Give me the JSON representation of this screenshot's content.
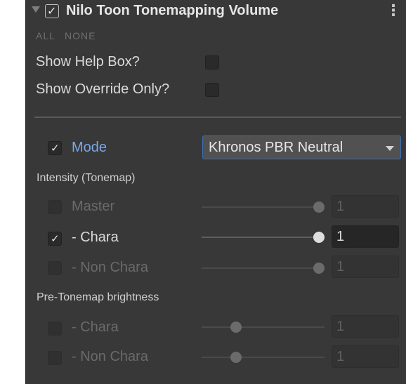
{
  "header": {
    "title": "Nilo Toon Tonemapping Volume",
    "enabled": true,
    "menu_glyph": "⋮",
    "collapse_glyph": "▼"
  },
  "quick_select": {
    "all": "ALL",
    "none": "NONE"
  },
  "options": {
    "show_help_box": {
      "label": "Show Help Box?",
      "checked": false
    },
    "show_override_only": {
      "label": "Show Override Only?",
      "checked": false
    }
  },
  "mode": {
    "label": "Mode",
    "override": true,
    "selected": "Khronos PBR Neutral"
  },
  "intensity_section": {
    "title": "Intensity (Tonemap)",
    "rows": [
      {
        "label": "Master",
        "override": false,
        "value": "1",
        "slider_fraction": 1.0
      },
      {
        "label": "-  Chara",
        "override": true,
        "value": "1",
        "slider_fraction": 1.0
      },
      {
        "label": "-  Non Chara",
        "override": false,
        "value": "1",
        "slider_fraction": 1.0
      }
    ]
  },
  "pretonemap_section": {
    "title": "Pre-Tonemap brightness",
    "rows": [
      {
        "label": "-  Chara",
        "override": false,
        "value": "1",
        "slider_fraction": 0.33
      },
      {
        "label": "-  Non Chara",
        "override": false,
        "value": "1",
        "slider_fraction": 0.33
      }
    ]
  },
  "colors": {
    "panel_bg": "#383838",
    "accent_blue": "#7aa7e8",
    "title_text": "#e6e6e6"
  }
}
